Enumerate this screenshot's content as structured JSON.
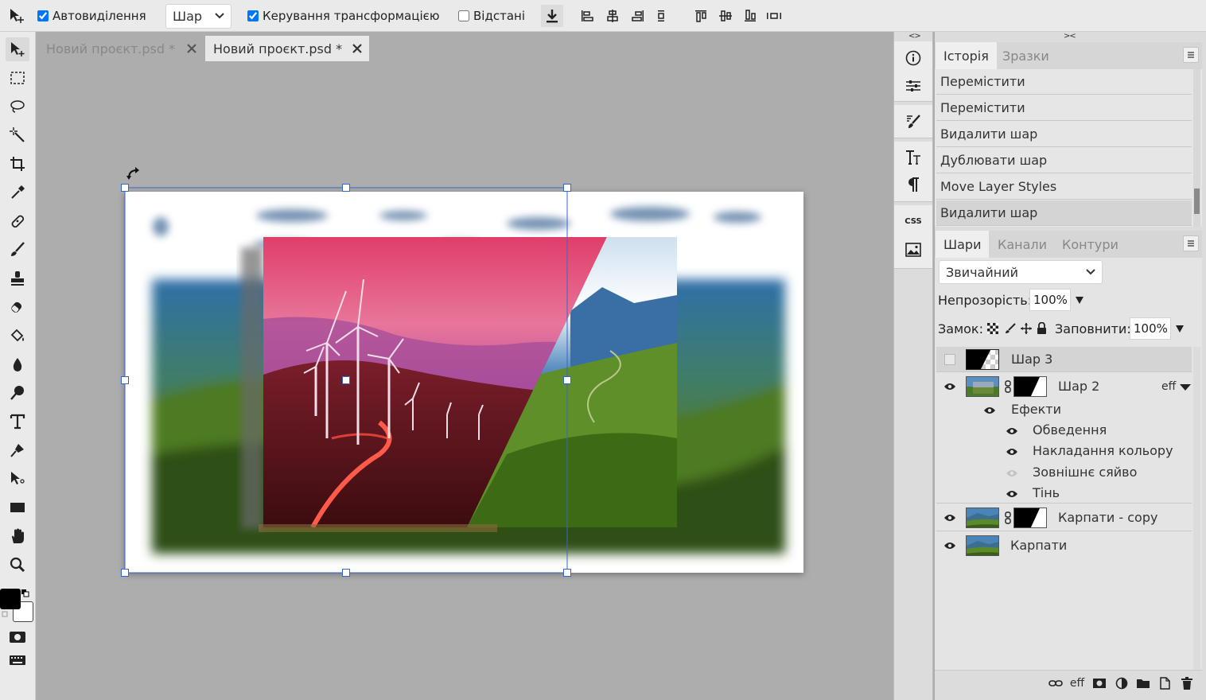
{
  "options_bar": {
    "auto_select_label": "Автовиділення",
    "auto_select_checked": true,
    "layer_select_value": "Шар",
    "transform_controls_label": "Керування трансформацією",
    "transform_controls_checked": true,
    "distances_label": "Відстані",
    "distances_checked": false
  },
  "tabs": [
    {
      "title": "Новий проєкт.psd *",
      "active": false
    },
    {
      "title": "Новий проєкт.psd *",
      "active": true
    }
  ],
  "icon_column": {
    "toggle_left": "<>",
    "toggle_right": "><",
    "css_label": "CSS"
  },
  "history_panel": {
    "tabs": [
      "Історія",
      "Зразки"
    ],
    "items": [
      "Перемістити",
      "Перемістити",
      "Видалити шар",
      "Дублювати шар",
      "Move Layer Styles",
      "Видалити шар"
    ],
    "active_index": 5
  },
  "layers_panel": {
    "tabs": [
      "Шари",
      "Канали",
      "Контури"
    ],
    "blend_mode": "Звичайний",
    "opacity_label": "Непрозорість:",
    "opacity_value": "100%",
    "lock_label": "Замок:",
    "fill_label": "Заповнити:",
    "fill_value": "100%",
    "layers": [
      {
        "name": "Шар 3",
        "visible": false
      },
      {
        "name": "Шар 2",
        "visible": true,
        "fx_badge": "eff"
      },
      {
        "name": "Карпати - copy",
        "visible": true
      },
      {
        "name": "Карпати",
        "visible": true
      }
    ],
    "effects": {
      "group_label": "Ефекти",
      "items": [
        {
          "name": "Обведення",
          "enabled": true
        },
        {
          "name": "Накладання кольору",
          "enabled": true
        },
        {
          "name": "Зовнішнє сяйво",
          "enabled": false
        },
        {
          "name": "Тінь",
          "enabled": true
        }
      ]
    },
    "bottom_fx_label": "eff"
  },
  "colors": {
    "foreground": "#000000",
    "background": "#ffffff",
    "selection": "#3a66c8"
  }
}
